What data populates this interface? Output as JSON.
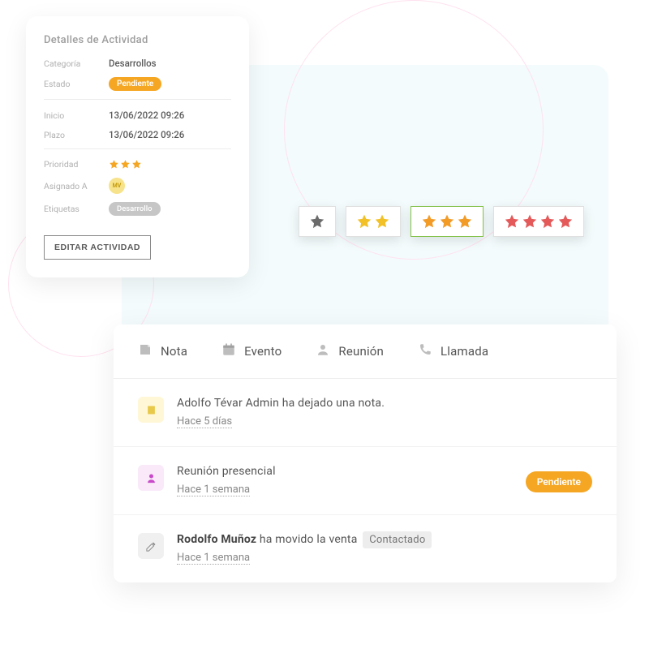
{
  "activity_details": {
    "title": "Detalles de Actividad",
    "labels": {
      "categoria": "Categoría",
      "estado": "Estado",
      "inicio": "Inicio",
      "plazo": "Plazo",
      "prioridad": "Prioridad",
      "asignado_a": "Asignado A",
      "etiquetas": "Etiquetas"
    },
    "values": {
      "categoria": "Desarrollos",
      "estado_badge": "Pendiente",
      "inicio": "13/06/2022 09:26",
      "plazo": "13/06/2022 09:26",
      "asignado_initials": "MV",
      "etiqueta": "Desarrollo"
    },
    "priority_stars": 3,
    "edit_button": "EDITAR ACTIVIDAD"
  },
  "rating_picker": {
    "options": [
      {
        "stars": 1,
        "color": "#6b6b6b"
      },
      {
        "stars": 2,
        "color": "#f2c027"
      },
      {
        "stars": 3,
        "color": "#f29b27",
        "selected": true
      },
      {
        "stars": 4,
        "color": "#e45a5a"
      }
    ]
  },
  "timeline": {
    "tabs": [
      {
        "id": "nota",
        "label": "Nota",
        "icon": "note-icon"
      },
      {
        "id": "evento",
        "label": "Evento",
        "icon": "calendar-icon"
      },
      {
        "id": "reunion",
        "label": "Reunión",
        "icon": "person-icon"
      },
      {
        "id": "llamada",
        "label": "Llamada",
        "icon": "phone-icon"
      }
    ],
    "items": [
      {
        "icon": "note",
        "text_plain": "Adolfo Tévar Admin ha dejado una nota.",
        "time": "Hace 5 días"
      },
      {
        "icon": "meeting",
        "text_plain": "Reunión presencial",
        "time": "Hace 1 semana",
        "side_badge": "Pendiente"
      },
      {
        "icon": "edit",
        "actor": "Rodolfo Muñoz",
        "action_text": " ha movido la venta ",
        "status_chip": "Contactado",
        "time": "Hace 1 semana"
      }
    ]
  }
}
